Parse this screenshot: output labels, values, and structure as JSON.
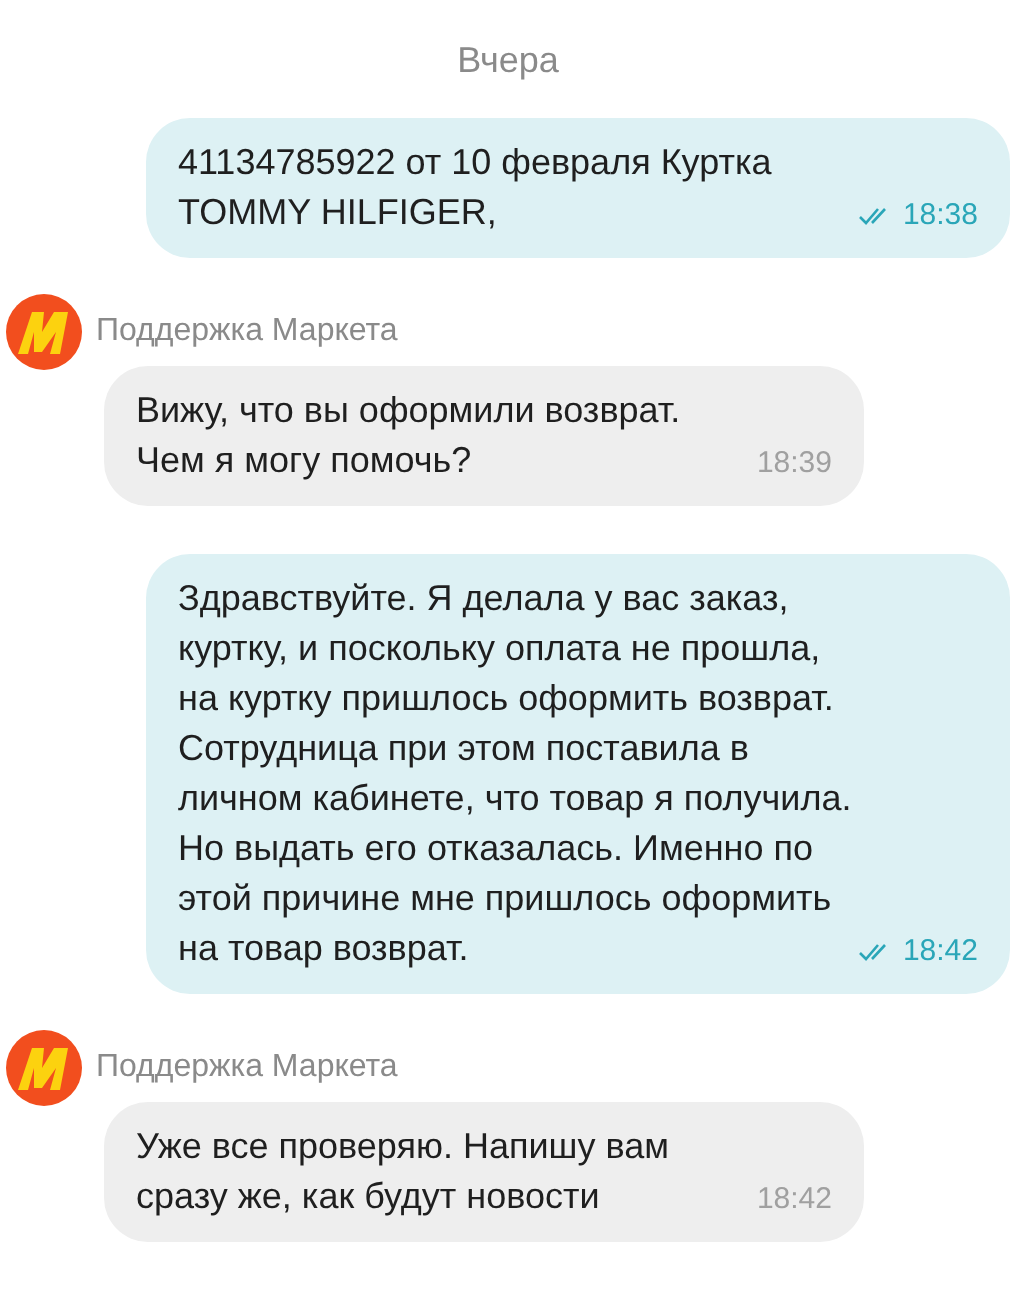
{
  "date_separator": "Вчера",
  "messages": [
    {
      "kind": "outgoing",
      "text": "41134785922 от 10 февраля Куртка TOMMY HILFIGER,",
      "time": "18:38",
      "read": true
    },
    {
      "kind": "incoming",
      "sender": "Поддержка Маркета",
      "text": "Вижу, что вы оформили возврат. Чем я могу помочь?",
      "time": "18:39"
    },
    {
      "kind": "outgoing",
      "text": "Здравствуйте. Я делала у вас заказ, куртку, и поскольку оплата не прошла, на куртку пришлось оформить возврат. Сотрудница при этом поставила в личном кабинете, что товар я получила. Но выдать его отказалась. Именно по этой причине мне пришлось оформить на товар возврат.",
      "time": "18:42",
      "read": true
    },
    {
      "kind": "incoming",
      "sender": "Поддержка Маркета",
      "text": "Уже все проверяю. Напишу вам сразу же, как будут новости",
      "time": "18:42"
    }
  ]
}
